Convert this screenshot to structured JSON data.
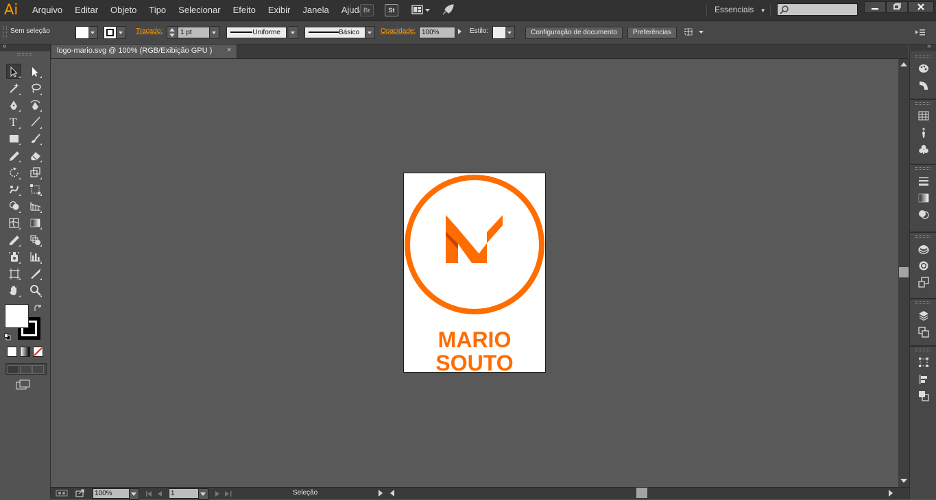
{
  "app": {
    "logo": "Ai",
    "accent": "#ff9a00"
  },
  "menu": [
    "Arquivo",
    "Editar",
    "Objeto",
    "Tipo",
    "Selecionar",
    "Efeito",
    "Exibir",
    "Janela",
    "Ajuda"
  ],
  "bridge_btn": "Br",
  "stock_btn": "St",
  "workspace": "Essenciais",
  "control": {
    "selection_status": "Sem seleção",
    "stroke_label": "Traçado:",
    "stroke_weight": "1 pt",
    "profile_label": "Uniforme",
    "brush_label": "Básico",
    "opacity_label": "Opacidade:",
    "opacity_value": "100%",
    "style_label": "Estilo:",
    "doc_setup_button": "Configuração de documento",
    "prefs_button": "Preferências"
  },
  "document": {
    "tab_title": "logo-mario.svg @ 100% (RGB/Exibição GPU )",
    "close_glyph": "×"
  },
  "artwork": {
    "line1": "MARIO",
    "line2": "SOUTO",
    "brand_color": "#ff6d00",
    "fold_color": "#c94400"
  },
  "status": {
    "zoom": "100%",
    "artboard_number": "1",
    "tool_name": "Seleção"
  },
  "tools": [
    "selection-tool",
    "direct-selection-tool",
    "magic-wand-tool",
    "lasso-tool",
    "pen-tool",
    "curvature-tool",
    "type-tool",
    "line-segment-tool",
    "rectangle-tool",
    "paintbrush-tool",
    "pencil-tool",
    "eraser-tool",
    "rotate-tool",
    "scale-tool",
    "warp-tool",
    "free-transform-tool",
    "shape-builder-tool",
    "perspective-grid-tool",
    "mesh-tool",
    "gradient-tool",
    "eyedropper-tool",
    "blend-tool",
    "symbol-sprayer-tool",
    "column-graph-tool",
    "artboard-tool",
    "slice-tool",
    "hand-tool",
    "zoom-tool"
  ],
  "right_panels": [
    "color-panel",
    "color-guide-panel",
    "swatches-panel",
    "brushes-panel",
    "symbols-panel",
    "stroke-panel",
    "gradient-panel",
    "transparency-panel",
    "appearance-panel",
    "graphic-styles-panel",
    "asset-export-panel",
    "layers-panel",
    "artboards-panel",
    "transform-panel",
    "align-panel",
    "pathfinder-panel"
  ]
}
